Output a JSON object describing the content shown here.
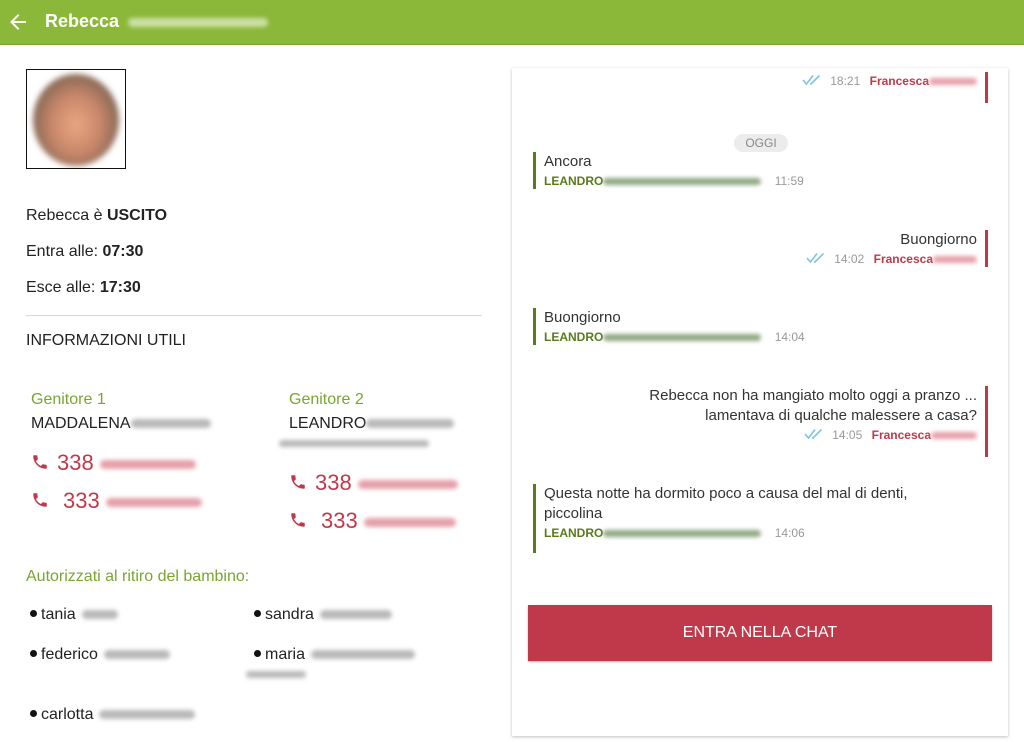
{
  "header": {
    "title": "Rebecca",
    "back_icon": "arrow-left-icon",
    "bar_color": "#8cb83a"
  },
  "child": {
    "status_prefix": "Rebecca è",
    "status_value": "USCITO",
    "entry_label": "Entra alle:",
    "entry_time": "07:30",
    "exit_label": "Esce alle:",
    "exit_time": "17:30"
  },
  "info": {
    "title": "INFORMAZIONI UTILI"
  },
  "parents": [
    {
      "title": "Genitore 1",
      "name": "MADDALENA",
      "phones": [
        "338",
        "333"
      ]
    },
    {
      "title": "Genitore 2",
      "name": "LEANDRO",
      "phones": [
        "338",
        "333"
      ]
    }
  ],
  "authorized": {
    "title": "Autorizzati al ritiro del bambino:",
    "people": [
      "tania",
      "sandra",
      "federico",
      "maria",
      "carlotta"
    ]
  },
  "chat": {
    "day_chip": "OGGI",
    "messages": [
      {
        "dir": "out",
        "text": "",
        "time": "18:21",
        "sender": "Francesca"
      },
      {
        "dir": "in",
        "text": "Ancora",
        "time": "11:59",
        "sender": "LEANDRO"
      },
      {
        "dir": "out",
        "text": "Buongiorno",
        "time": "14:02",
        "sender": "Francesca"
      },
      {
        "dir": "in",
        "text": "Buongiorno",
        "time": "14:04",
        "sender": "LEANDRO"
      },
      {
        "dir": "out",
        "text_line1": "Rebecca non ha mangiato molto oggi a pranzo ...",
        "text_line2": "lamentava di qualche malessere a casa?",
        "time": "14:05",
        "sender": "Francesca"
      },
      {
        "dir": "in",
        "text_line1": "Questa notte ha dormito poco a causa del mal di denti,",
        "text_line2": "piccolina",
        "time": "14:06",
        "sender": "LEANDRO"
      }
    ],
    "enter_button": "ENTRA NELLA CHAT"
  },
  "colors": {
    "accent_green": "#7aa530",
    "accent_red": "#c0394b",
    "incoming_border": "#5a7a1d",
    "read_ticks": "#7fc4e0"
  },
  "icons": {
    "phone": "phone-icon",
    "read": "double-check-icon"
  }
}
